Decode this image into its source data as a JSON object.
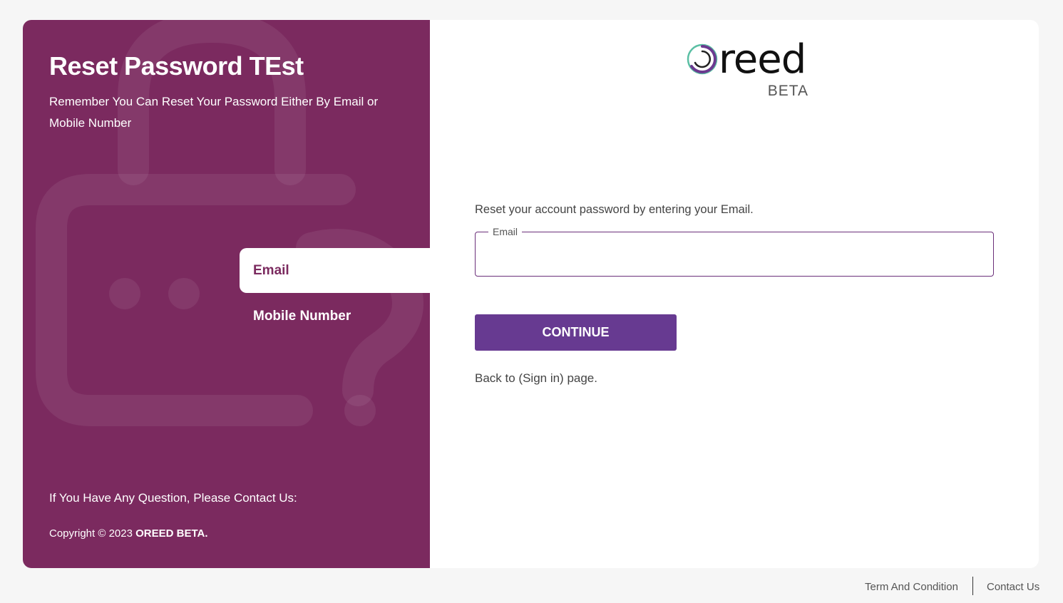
{
  "left_panel": {
    "title": "Reset Password TEst",
    "subtitle": "Remember You Can Reset Your Password Either By Email or Mobile Number",
    "methods": [
      {
        "label": "Email",
        "active": true
      },
      {
        "label": "Mobile Number",
        "active": false
      }
    ],
    "contact_question": "If You Have Any Question, Please Contact Us:",
    "copyright_prefix": "Copyright © 2023",
    "copyright_brand": "OREED BETA.",
    "background_color": "#7b2a5f"
  },
  "logo": {
    "word": "reed",
    "badge": "BETA",
    "icon": "oreed-ring-logo-icon"
  },
  "form": {
    "description": "Reset your account password by entering your Email.",
    "email_label": "Email",
    "email_value": "",
    "continue_label": "CONTINUE",
    "back_text": "Back to (Sign in) page.",
    "accent_color": "#673a91"
  },
  "footer": {
    "terms": "Term And Condition",
    "contact": "Contact Us"
  }
}
